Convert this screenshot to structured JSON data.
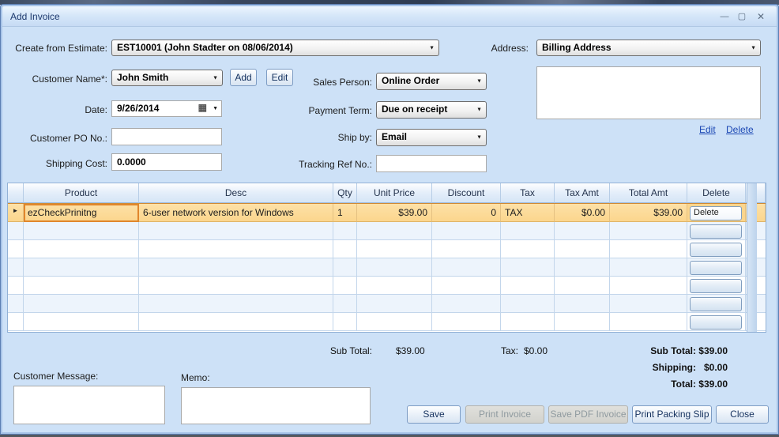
{
  "window": {
    "title": "Add Invoice"
  },
  "icons": {
    "dropdown_arrow": "▼",
    "calendar": "▦",
    "row_selector": "►",
    "minimize": "—",
    "maximize": "▢",
    "close": "✕"
  },
  "form": {
    "create_from_estimate": {
      "label": "Create from Estimate:",
      "value": "EST10001 (John Stadter on 08/06/2014)"
    },
    "address": {
      "label": "Address:",
      "value": "Billing Address",
      "edit_link": "Edit",
      "delete_link": "Delete"
    },
    "customer_name": {
      "label": "Customer Name*:",
      "value": "John Smith",
      "add_button": "Add",
      "edit_button": "Edit"
    },
    "sales_person": {
      "label": "Sales Person:",
      "value": "Online Order"
    },
    "date": {
      "label": "Date:",
      "value": "9/26/2014"
    },
    "payment_term": {
      "label": "Payment Term:",
      "value": "Due on receipt"
    },
    "customer_po": {
      "label": "Customer PO No.:",
      "value": ""
    },
    "ship_by": {
      "label": "Ship by:",
      "value": "Email"
    },
    "shipping_cost": {
      "label": "Shipping Cost:",
      "value": "0.0000"
    },
    "tracking_ref": {
      "label": "Tracking Ref No.:",
      "value": ""
    }
  },
  "grid": {
    "columns": {
      "product": "Product",
      "desc": "Desc",
      "qty": "Qty",
      "unit_price": "Unit Price",
      "discount": "Discount",
      "tax": "Tax",
      "tax_amt": "Tax Amt",
      "total_amt": "Total Amt",
      "delete": "Delete"
    },
    "rows": [
      {
        "product": "ezCheckPrinitng",
        "desc": "6-user network version for Windows",
        "qty": "1",
        "unit_price": "$39.00",
        "discount": "0",
        "tax": "TAX",
        "tax_amt": "$0.00",
        "total_amt": "$39.00",
        "delete_label": "Delete"
      }
    ],
    "empty_row_count": 6
  },
  "totals": {
    "mid": {
      "sub_total_label": "Sub Total:",
      "sub_total": "$39.00",
      "tax_label": "Tax:",
      "tax": "$0.00"
    },
    "right": {
      "sub_total_label": "Sub Total:",
      "sub_total": "$39.00",
      "shipping_label": "Shipping:",
      "shipping": "$0.00",
      "total_label": "Total:",
      "total": "$39.00"
    }
  },
  "footer": {
    "customer_message_label": "Customer Message:",
    "memo_label": "Memo:",
    "buttons": {
      "save": "Save",
      "print_invoice": "Print Invoice",
      "save_pdf": "Save PDF Invoice",
      "print_packing": "Print Packing Slip",
      "close": "Close"
    }
  },
  "colors": {
    "dialog_bg": "#cde1f7",
    "selected_row": "#fbd58c",
    "selected_cell_border": "#e0862c",
    "link": "#1c48b4",
    "title_text": "#1e3a6e"
  }
}
